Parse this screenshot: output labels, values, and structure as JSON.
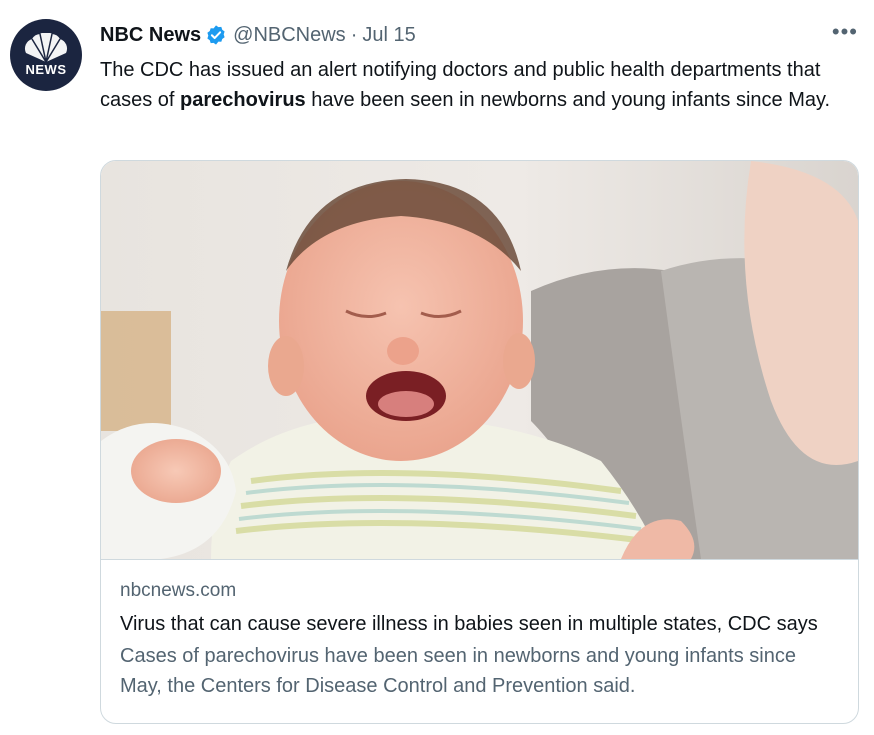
{
  "tweet": {
    "author_name": "NBC News",
    "handle": "@NBCNews",
    "separator": "·",
    "date": "Jul 15",
    "more_label": "•••",
    "avatar_text": "NEWS",
    "text_before": "The CDC has issued an alert notifying doctors and public health departments that cases of ",
    "text_bold": "parechovirus",
    "text_after": " have been seen in newborns and young infants since May."
  },
  "card": {
    "domain": "nbcnews.com",
    "title": "Virus that can cause severe illness in babies seen in multiple states, CDC says",
    "description": "Cases of parechovirus have been seen in newborns and young infants since May, the Centers for Disease Control and Prevention said."
  },
  "colors": {
    "verified": "#1d9bf0",
    "secondary_text": "#536471",
    "avatar_bg": "#1b2540"
  }
}
